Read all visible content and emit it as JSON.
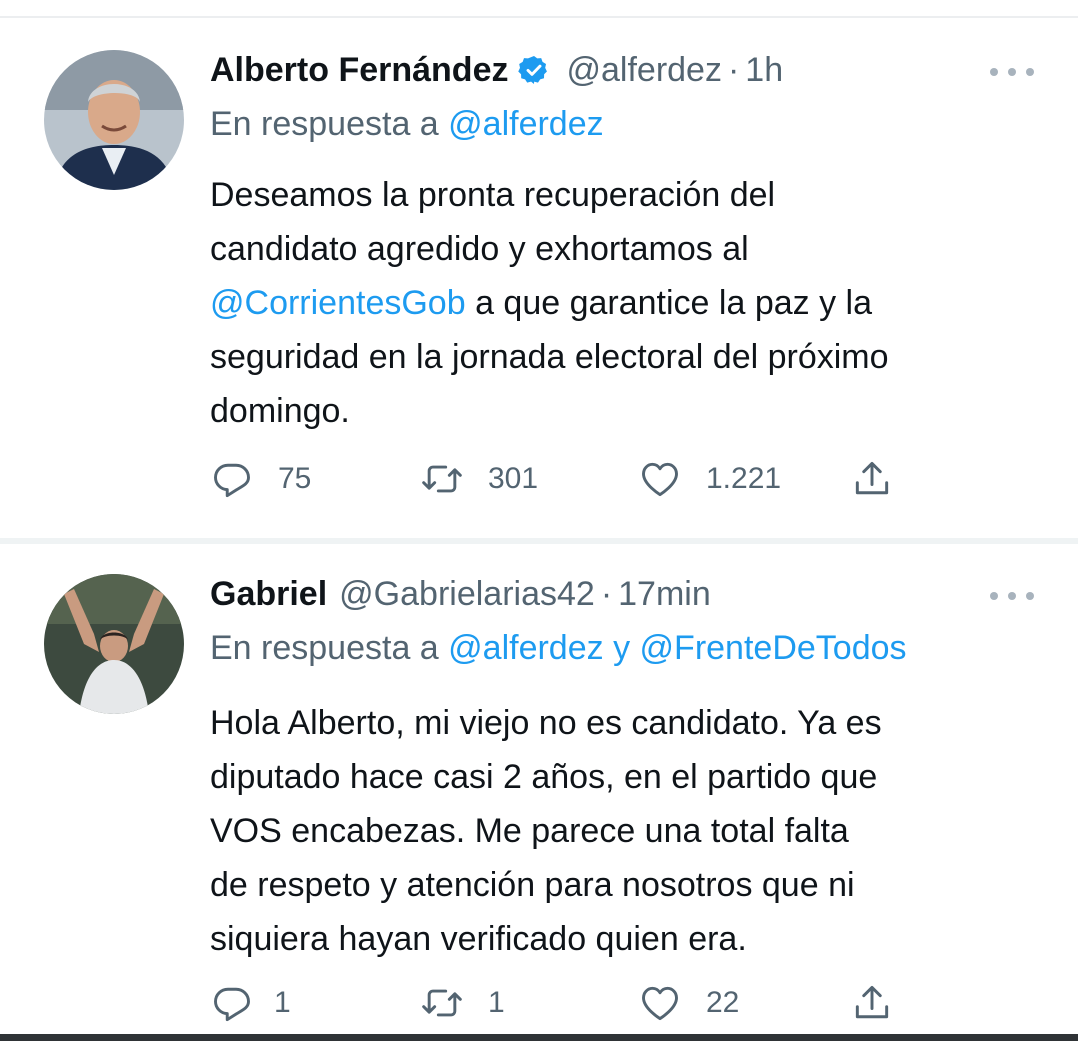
{
  "tweets": [
    {
      "display_name": "Alberto Fernández",
      "verified": true,
      "handle": "@alferdez",
      "separator": "·",
      "time": "1h",
      "reply_prefix": "En respuesta a",
      "reply_mentions": [
        "@alferdez"
      ],
      "reply_joiner": "",
      "body_lines": [
        [
          {
            "text": "Deseamos la pronta recuperación del",
            "mention": false
          }
        ],
        [
          {
            "text": "candidato agredido y exhortamos al",
            "mention": false
          }
        ],
        [
          {
            "text": "@CorrientesGob",
            "mention": true
          },
          {
            "text": " a que garantice la paz y la",
            "mention": false
          }
        ],
        [
          {
            "text": "seguridad en la jornada electoral del próximo",
            "mention": false
          }
        ],
        [
          {
            "text": "domingo.",
            "mention": false
          }
        ]
      ],
      "replies": "75",
      "retweets": "301",
      "likes": "1.221",
      "avatar_icon": "profile-photo-suited-man-smiling"
    },
    {
      "display_name": "Gabriel",
      "verified": false,
      "handle": "@Gabrielarias42",
      "separator": "·",
      "time": "17min",
      "reply_prefix": "En respuesta a",
      "reply_mentions": [
        "@alferdez",
        "@FrenteDeTodos"
      ],
      "reply_joiner": "y",
      "body_lines": [
        [
          {
            "text": "Hola Alberto, mi viejo no es candidato. Ya es",
            "mention": false
          }
        ],
        [
          {
            "text": "diputado hace casi 2 años, en el partido que",
            "mention": false
          }
        ],
        [
          {
            "text": "VOS encabezas. Me parece una total falta",
            "mention": false
          }
        ],
        [
          {
            "text": "de respeto y atención para nosotros que ni",
            "mention": false
          }
        ],
        [
          {
            "text": "siquiera hayan verificado quien era.",
            "mention": false
          }
        ]
      ],
      "replies": "1",
      "retweets": "1",
      "likes": "22",
      "avatar_icon": "profile-photo-rugby-player-celebrating"
    }
  ],
  "icons": {
    "reply": "reply-icon",
    "retweet": "retweet-icon",
    "like": "like-icon",
    "share": "share-icon",
    "more": "more-options-icon",
    "verified": "verified-badge-icon"
  },
  "colors": {
    "text": "#0f1419",
    "secondary": "#536471",
    "link": "#1d9bf0",
    "verified": "#1d9bf0",
    "divider": "#eff3f4"
  }
}
